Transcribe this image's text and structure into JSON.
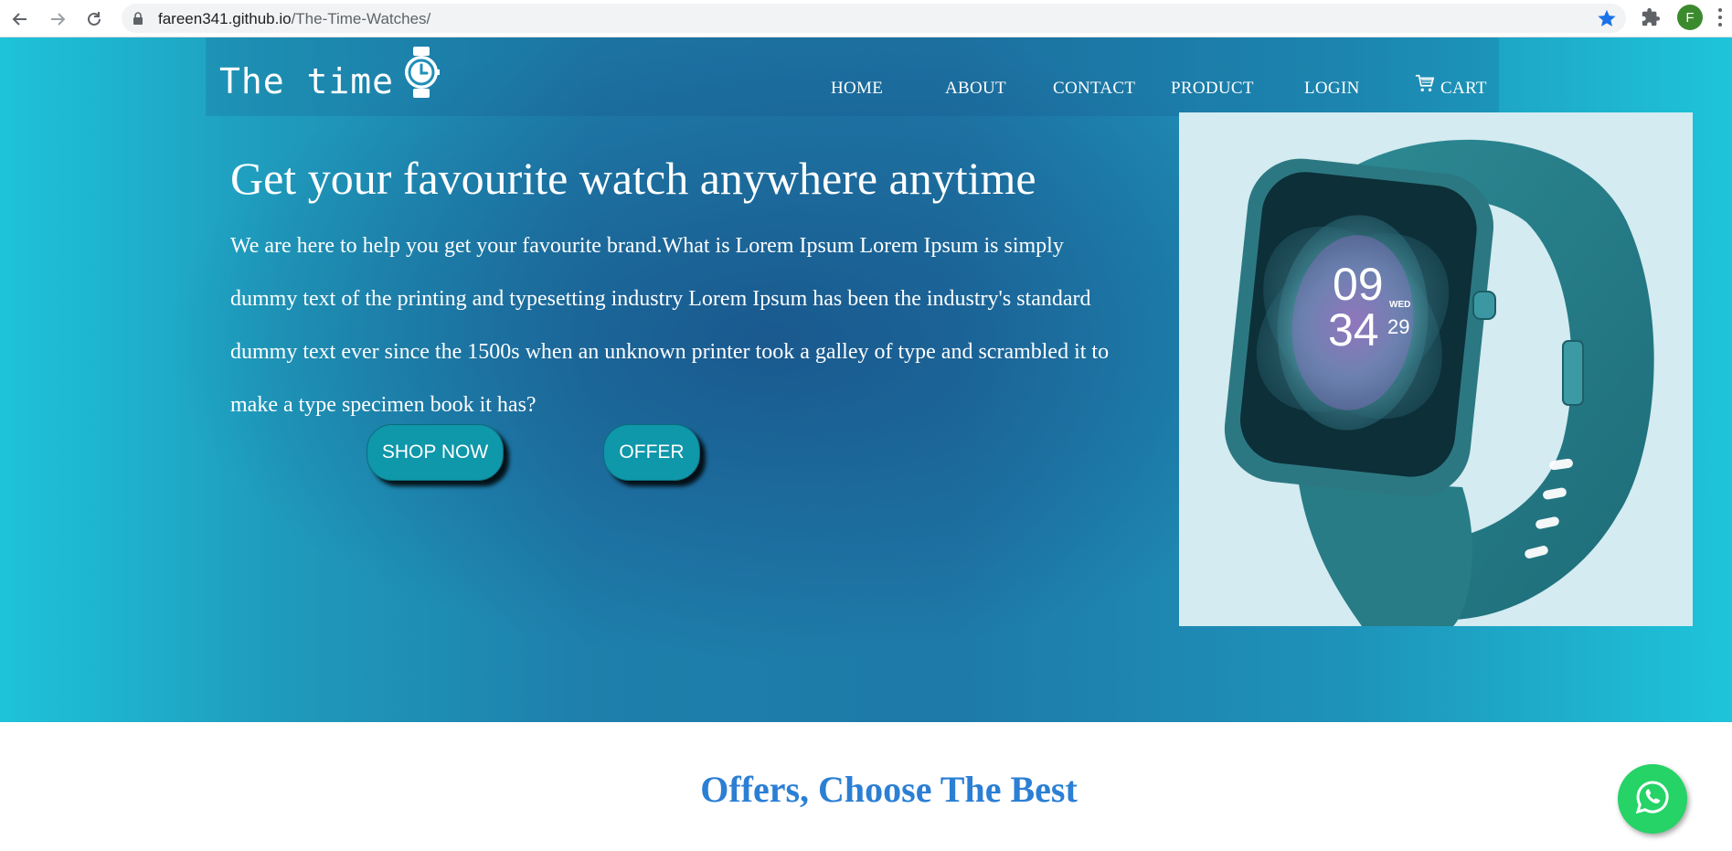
{
  "browser": {
    "url_domain": "fareen341.github.io",
    "url_path": "/The-Time-Watches/",
    "profile_initial": "F",
    "icons": [
      "back-arrow-icon",
      "forward-arrow-icon",
      "reload-icon",
      "lock-icon",
      "bookmark-star-icon",
      "extensions-puzzle-icon",
      "more-menu-icon"
    ]
  },
  "brand": {
    "logo_text": "The time",
    "logo_icon": "watch-icon"
  },
  "nav": {
    "home": "HOME",
    "about": "ABOUT",
    "contact": "CONTACT",
    "product": "PRODUCT",
    "login": "LOGIN",
    "cart": "CART",
    "cart_icon": "shopping-cart-icon"
  },
  "hero": {
    "headline": "Get your favourite watch anywhere anytime",
    "paragraph": "We are here to help you get your favourite brand.What is Lorem Ipsum Lorem Ipsum is simply dummy text of the printing and typesetting industry Lorem Ipsum has been the industry's standard dummy text ever since the 1500s when an unknown printer took a galley of type and scrambled it to make a type specimen book it has?",
    "shop_now": "SHOP NOW",
    "offer": "OFFER"
  },
  "product_image": {
    "watch_hour": "09",
    "watch_minute": "34",
    "watch_day": "WED",
    "watch_date": "29"
  },
  "offers": {
    "title": "Offers, Choose The Best"
  },
  "floating": {
    "icon": "whatsapp-icon"
  },
  "colors": {
    "hero_edge": "#1ec3da",
    "hero_center": "#1e7aa8",
    "button": "#0f97aa",
    "offers_title": "#2b7fd4",
    "whatsapp": "#25d366"
  }
}
